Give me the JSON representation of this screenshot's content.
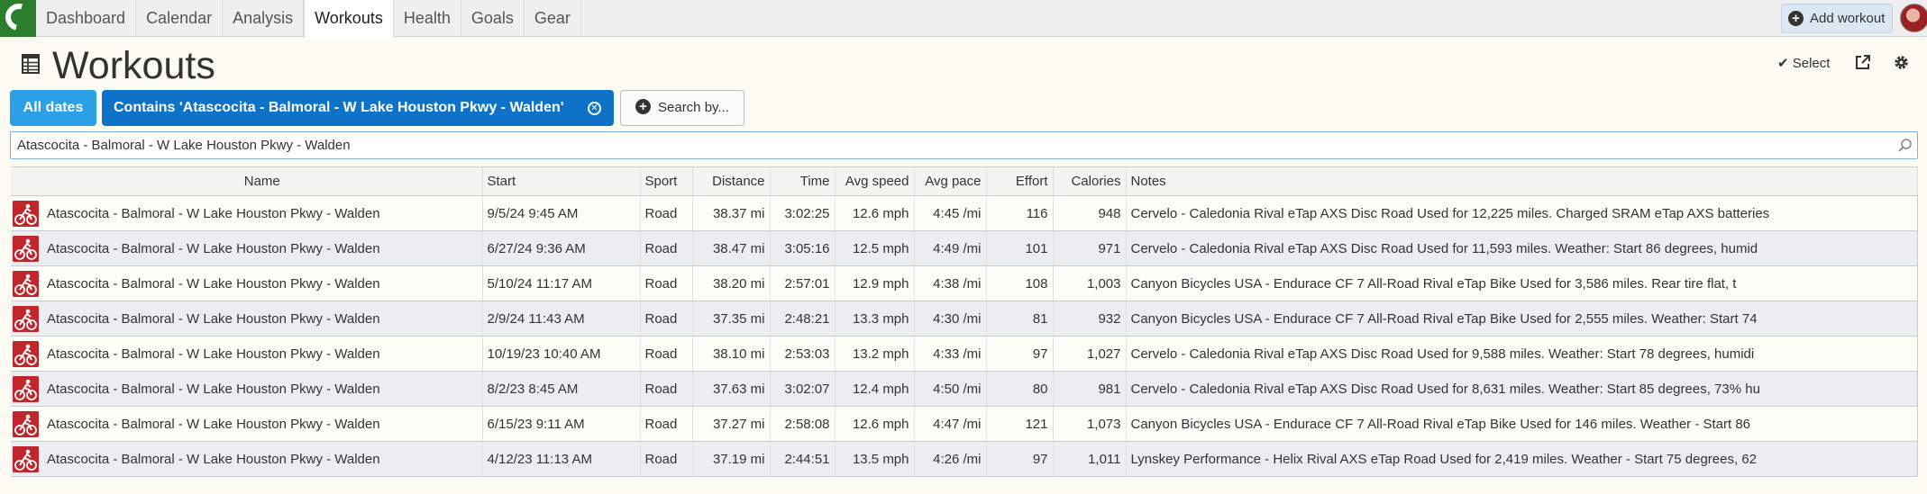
{
  "nav": {
    "tabs": [
      {
        "label": "Dashboard",
        "active": false
      },
      {
        "label": "Calendar",
        "active": false
      },
      {
        "label": "Analysis",
        "active": false
      },
      {
        "label": "Workouts",
        "active": true
      },
      {
        "label": "Health",
        "active": false
      },
      {
        "label": "Goals",
        "active": false
      },
      {
        "label": "Gear",
        "active": false
      }
    ],
    "add_workout_label": "Add workout"
  },
  "header": {
    "title": "Workouts",
    "select_label": "Select"
  },
  "filters": {
    "all_dates_label": "All dates",
    "contains_label": "Contains 'Atascocita - Balmoral - W Lake Houston Pkwy - Walden'",
    "search_by_label": "Search by..."
  },
  "search": {
    "value": "Atascocita - Balmoral - W Lake Houston Pkwy - Walden"
  },
  "table": {
    "columns": {
      "name": "Name",
      "start": "Start",
      "sport": "Sport",
      "distance": "Distance",
      "time": "Time",
      "avg_speed": "Avg speed",
      "avg_pace": "Avg pace",
      "effort": "Effort",
      "calories": "Calories",
      "notes": "Notes"
    },
    "rows": [
      {
        "name": "Atascocita - Balmoral - W Lake Houston Pkwy - Walden",
        "start": "9/5/24 9:45 AM",
        "sport": "Road",
        "distance": "38.37 mi",
        "time": "3:02:25",
        "avg_speed": "12.6 mph",
        "avg_pace": "4:45 /mi",
        "effort": "116",
        "calories": "948",
        "notes": "Cervelo - Caledonia Rival eTap AXS Disc Road Used for 12,225 miles. Charged SRAM eTap AXS batteries"
      },
      {
        "name": "Atascocita - Balmoral - W Lake Houston Pkwy - Walden",
        "start": "6/27/24 9:36 AM",
        "sport": "Road",
        "distance": "38.47 mi",
        "time": "3:05:16",
        "avg_speed": "12.5 mph",
        "avg_pace": "4:49 /mi",
        "effort": "101",
        "calories": "971",
        "notes": "Cervelo - Caledonia Rival eTap AXS Disc Road Used for 11,593 miles. Weather: Start 86 degrees, humid"
      },
      {
        "name": "Atascocita - Balmoral - W Lake Houston Pkwy - Walden",
        "start": "5/10/24 11:17 AM",
        "sport": "Road",
        "distance": "38.20 mi",
        "time": "2:57:01",
        "avg_speed": "12.9 mph",
        "avg_pace": "4:38 /mi",
        "effort": "108",
        "calories": "1,003",
        "notes": "Canyon Bicycles USA - Endurace CF 7 All-Road Rival eTap Bike Used for 3,586 miles. Rear tire flat, t"
      },
      {
        "name": "Atascocita - Balmoral - W Lake Houston Pkwy - Walden",
        "start": "2/9/24 11:43 AM",
        "sport": "Road",
        "distance": "37.35 mi",
        "time": "2:48:21",
        "avg_speed": "13.3 mph",
        "avg_pace": "4:30 /mi",
        "effort": "81",
        "calories": "932",
        "notes": "Canyon Bicycles USA - Endurace CF 7 All-Road Rival eTap Bike Used for 2,555 miles. Weather: Start 74"
      },
      {
        "name": "Atascocita - Balmoral - W Lake Houston Pkwy - Walden",
        "start": "10/19/23 10:40 AM",
        "sport": "Road",
        "distance": "38.10 mi",
        "time": "2:53:03",
        "avg_speed": "13.2 mph",
        "avg_pace": "4:33 /mi",
        "effort": "97",
        "calories": "1,027",
        "notes": "Cervelo - Caledonia Rival eTap AXS Disc Road Used for 9,588 miles. Weather: Start 78 degrees, humidi"
      },
      {
        "name": "Atascocita - Balmoral - W Lake Houston Pkwy - Walden",
        "start": "8/2/23 8:45 AM",
        "sport": "Road",
        "distance": "37.63 mi",
        "time": "3:02:07",
        "avg_speed": "12.4 mph",
        "avg_pace": "4:50 /mi",
        "effort": "80",
        "calories": "981",
        "notes": "Cervelo - Caledonia Rival eTap AXS Disc Road Used for 8,631 miles. Weather: Start 85 degrees, 73% hu"
      },
      {
        "name": "Atascocita - Balmoral - W Lake Houston Pkwy - Walden",
        "start": "6/15/23 9:11 AM",
        "sport": "Road",
        "distance": "37.27 mi",
        "time": "2:58:08",
        "avg_speed": "12.6 mph",
        "avg_pace": "4:47 /mi",
        "effort": "121",
        "calories": "1,073",
        "notes": "Canyon Bicycles USA - Endurace CF 7 All-Road Rival eTap Bike Used for 146 miles. Weather - Start 86"
      },
      {
        "name": "Atascocita - Balmoral - W Lake Houston Pkwy - Walden",
        "start": "4/12/23 11:13 AM",
        "sport": "Road",
        "distance": "37.19 mi",
        "time": "2:44:51",
        "avg_speed": "13.5 mph",
        "avg_pace": "4:26 /mi",
        "effort": "97",
        "calories": "1,011",
        "notes": "Lynskey Performance - Helix Rival AXS eTap Road Used for 2,419 miles. Weather - Start 75 degrees, 62"
      }
    ]
  },
  "colors": {
    "accent": "#0e73c8",
    "chip_light": "#2ba0e6",
    "sport_icon": "#c0262b",
    "logo": "#2d7d2f"
  },
  "icons": {
    "logo": "app-logo-icon",
    "page": "table-icon",
    "select": "checkmark-icon",
    "share": "share-icon",
    "settings": "gear-icon",
    "search": "magnifier-icon",
    "sport": "cycling-icon"
  }
}
